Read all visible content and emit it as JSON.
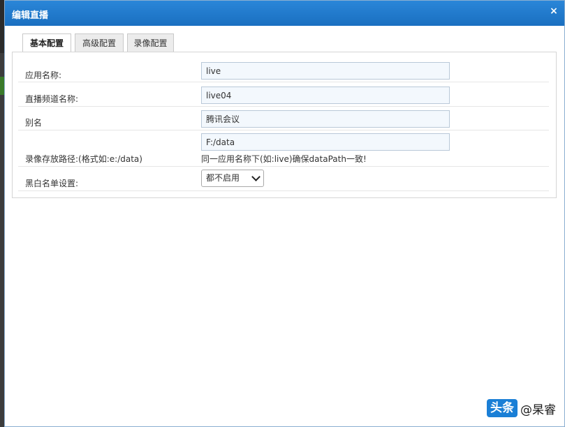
{
  "dialog": {
    "title": "编辑直播",
    "close_glyph": "×"
  },
  "tabs": [
    {
      "label": "基本配置",
      "active": true
    },
    {
      "label": "高级配置",
      "active": false
    },
    {
      "label": "录像配置",
      "active": false
    }
  ],
  "form": {
    "app_name": {
      "label": "应用名称:",
      "value": "live"
    },
    "channel_name": {
      "label": "直播频道名称:",
      "value": "live04"
    },
    "alias": {
      "label": "别名",
      "value": "腾讯会议"
    },
    "record_path": {
      "label": "录像存放路径:(格式如:e:/data)",
      "value": "F:/data",
      "hint": "同一应用名称下(如:live)确保dataPath一致!"
    },
    "blacklist": {
      "label": "黑白名单设置:",
      "selected": "都不启用"
    }
  },
  "watermark": {
    "badge": "头条",
    "handle": "@杲睿"
  },
  "colors": {
    "titlebar": "#1a6fc0",
    "input_bg": "#f3f8fd"
  }
}
